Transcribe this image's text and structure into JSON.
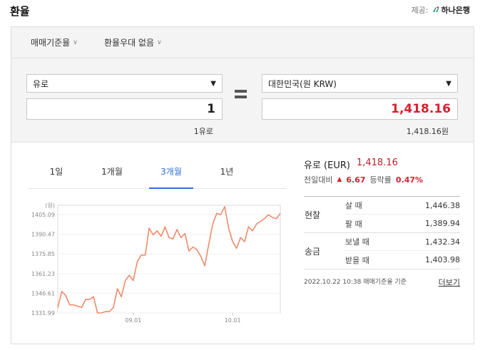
{
  "header": {
    "title": "환율",
    "provider_label": "제공:",
    "provider_name": "하나은행"
  },
  "filters": [
    {
      "label": "매매기준율"
    },
    {
      "label": "환율우대 없음"
    }
  ],
  "converter": {
    "from_currency": "유로",
    "from_amount": "1",
    "from_caption": "1유로",
    "to_currency": "대한민국(원 KRW)",
    "to_amount": "1,418.16",
    "to_caption": "1,418.16원"
  },
  "tabs": [
    {
      "label": "1일"
    },
    {
      "label": "1개월"
    },
    {
      "label": "3개월",
      "active": true
    },
    {
      "label": "1년"
    }
  ],
  "info": {
    "currency": "유로 (EUR)",
    "rate": "1,418.16",
    "change_label": "전일대비",
    "change_value": "6.67",
    "change_direction": "up",
    "pct_label": "등락률",
    "pct_value": "0.47%"
  },
  "rate_table": [
    {
      "group": "현찰",
      "rows": [
        {
          "label": "살 때",
          "value": "1,446.38"
        },
        {
          "label": "팔 때",
          "value": "1,389.94"
        }
      ]
    },
    {
      "group": "송금",
      "rows": [
        {
          "label": "보낼 때",
          "value": "1,432.34"
        },
        {
          "label": "받을 때",
          "value": "1,403.98"
        }
      ]
    }
  ],
  "footer": {
    "timestamp": "2022.10.22 10:38",
    "basis": "매매기준율 기준",
    "more": "더보기"
  },
  "colors": {
    "line": "#f08a6a",
    "accent": "#2f6fd6",
    "red": "#d6212e"
  },
  "chart_data": {
    "type": "line",
    "unit_label": "(원)",
    "yticks": [
      "1405.09",
      "1390.47",
      "1375.85",
      "1361.23",
      "1346.61",
      "1331.99"
    ],
    "ylim": [
      1331.99,
      1412
    ],
    "xtick_labels": [
      {
        "label": "09.01",
        "index": 19
      },
      {
        "label": "10.01",
        "index": 44
      }
    ],
    "series": [
      {
        "values": [
          1336,
          1348,
          1345,
          1338,
          1338,
          1337,
          1336,
          1342,
          1342,
          1344,
          1332,
          1331.99,
          1333,
          1333,
          1336,
          1350,
          1344,
          1356,
          1360,
          1356,
          1370,
          1375,
          1375,
          1395,
          1390,
          1393,
          1389,
          1396,
          1388,
          1387,
          1394,
          1388,
          1391,
          1378,
          1381,
          1379,
          1374,
          1367,
          1383,
          1398,
          1406,
          1405,
          1411,
          1395,
          1385,
          1380,
          1388,
          1385,
          1396,
          1393,
          1398,
          1400,
          1402,
          1405,
          1403,
          1402,
          1406
        ]
      }
    ]
  }
}
